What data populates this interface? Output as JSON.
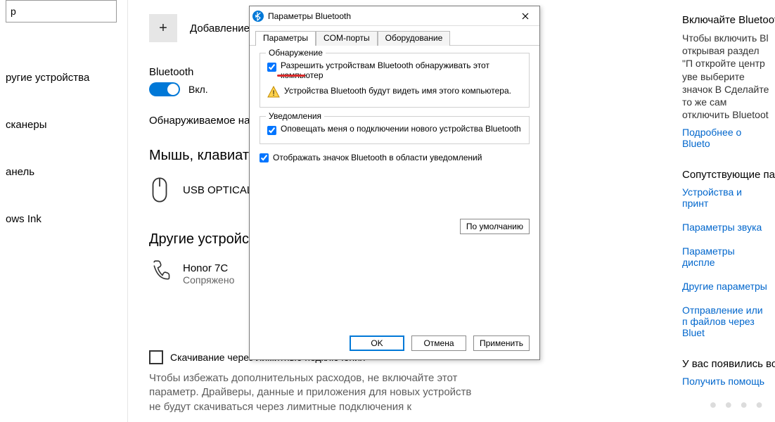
{
  "sidebar": {
    "search_placeholder": "р",
    "items": [
      "ругие устройства",
      "сканеры",
      "анель",
      "ows Ink"
    ]
  },
  "main": {
    "add_label": "Добавление",
    "bt_section": "Bluetooth",
    "toggle_state": "Вкл.",
    "discoverable": "Обнаруживаемое на",
    "mouse_h": "Мышь, клавиату",
    "mouse_name": "USB OPTICAL",
    "other_h": "Другие устройс",
    "phone_name": "Honor 7C",
    "phone_status": "Сопряжено",
    "metered_checkbox": "Скачивание через лимитные подключения",
    "metered_desc": "Чтобы избежать дополнительных расходов, не включайте этот параметр. Драйверы, данные и приложения для новых устройств не будут скачиваться через лимитные подключения к"
  },
  "dialog": {
    "title": "Параметры Bluetooth",
    "tabs": [
      "Параметры",
      "COM-порты",
      "Оборудование"
    ],
    "discovery_legend": "Обнаружение",
    "discovery_check": "Разрешить устройствам Bluetooth обнаруживать этот компьютер",
    "discovery_warn": "Устройства Bluetooth будут видеть имя этого компьютера.",
    "notify_legend": "Уведомления",
    "notify_check": "Оповещать меня о подключении нового устройства Bluetooth",
    "tray_check": "Отображать значок Bluetooth в области уведомлений",
    "default_btn": "По умолчанию",
    "ok": "OK",
    "cancel": "Отмена",
    "apply": "Применить"
  },
  "right": {
    "turn_on_h": "Включайте Bluetoot",
    "turn_on_text": "Чтобы включить Bl открывая раздел \"П откройте центр уве выберите значок В Сделайте то же сам отключить Bluetoot",
    "turn_on_link": "Подробнее о Blueto",
    "related_h": "Сопутствующие пар",
    "link_devices": "Устройства и принт",
    "link_sound": "Параметры звука",
    "link_display": "Параметры диспле",
    "link_other": "Другие параметры",
    "link_send": "Отправление или п файлов через Bluet",
    "questions_h": "У вас появились во",
    "help_link": "Получить помощь"
  }
}
